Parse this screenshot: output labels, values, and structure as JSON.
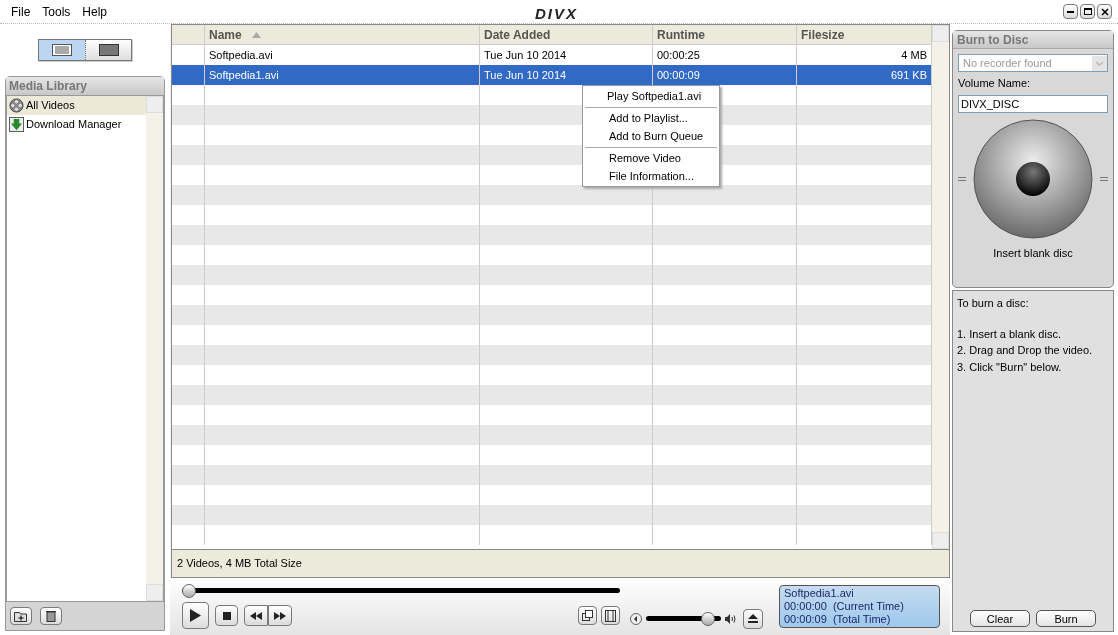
{
  "menu": [
    "File",
    "Tools",
    "Help"
  ],
  "logo": "DIVX",
  "view_toggle": [
    {
      "kind": "list",
      "selected": true
    },
    {
      "kind": "tile",
      "selected": false
    }
  ],
  "media_library": {
    "title": "Media Library",
    "items": [
      {
        "label": "All Videos",
        "kind": "reel",
        "selected": true
      },
      {
        "label": "Download Manager",
        "kind": "download",
        "selected": false
      }
    ]
  },
  "table": {
    "columns": [
      {
        "label": "Name",
        "sorted": true
      },
      {
        "label": "Date Added",
        "sorted": false
      },
      {
        "label": "Runtime",
        "sorted": false
      },
      {
        "label": "Filesize",
        "sorted": false
      }
    ],
    "rows": [
      {
        "cells": [
          "Softpedia.avi",
          "Tue Jun 10 2014",
          "00:00:25",
          "4 MB"
        ],
        "selected": false
      },
      {
        "cells": [
          "Softpedia1.avi",
          "Tue Jun 10 2014",
          "00:00:09",
          "691 KB"
        ],
        "selected": true
      }
    ]
  },
  "context_menu": [
    [
      "Play Softpedia1.avi"
    ],
    [
      "Add to Playlist...",
      "Add to Burn Queue"
    ],
    [
      "Remove Video",
      "File Information..."
    ]
  ],
  "status_bar": "2 Videos, 4 MB Total Size",
  "player": {
    "seek": {
      "level": 0.0
    },
    "volume": {
      "level": 0.9
    },
    "now_playing": [
      "Softpedia1.avi",
      "00:00:00  (Current Time)",
      "00:00:09  (Total Time)"
    ]
  },
  "burn": {
    "title": "Burn to Disc",
    "recorder": "No recorder found",
    "volume_label": "Volume Name:",
    "volume_value": "DIVX_DISC",
    "disc_caption": "Insert blank disc",
    "instructions_title": "To burn a disc:",
    "steps": [
      "1. Insert a blank disc.",
      "2. Drag and Drop the video.",
      "3. Click \"Burn\" below."
    ],
    "buttons": [
      "Clear",
      "Burn"
    ]
  }
}
